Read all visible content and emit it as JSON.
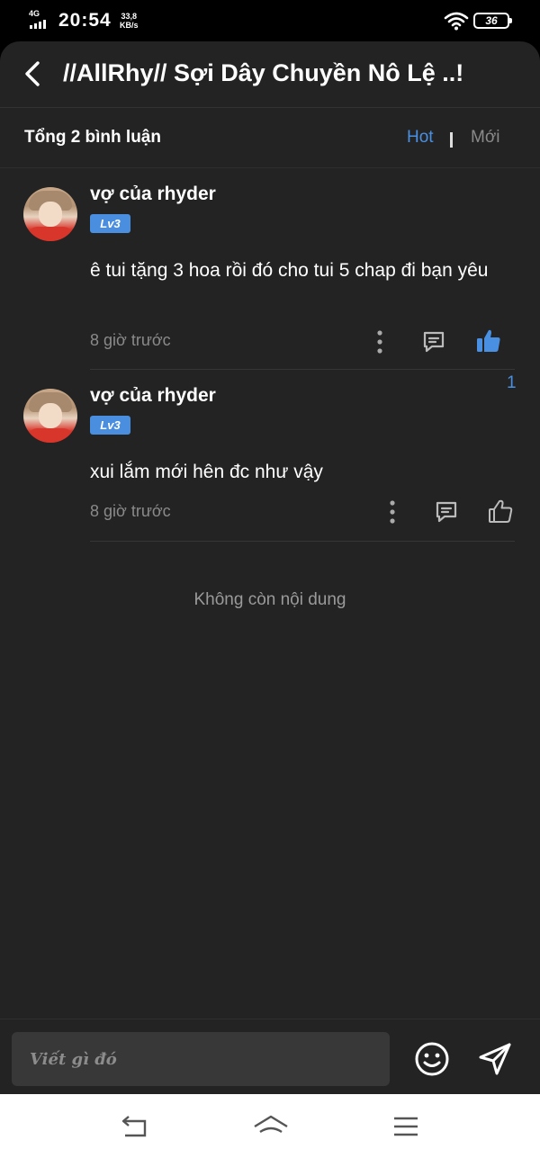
{
  "status_bar": {
    "network": "4G",
    "time": "20:54",
    "speed_value": "33,8",
    "speed_unit": "KB/s",
    "battery": "36"
  },
  "header": {
    "title": "//AllRhy// Sợi Dây Chuyền Nô Lệ ..!",
    "back_icon": "chevron-left-icon"
  },
  "comments_header": {
    "count_label": "Tổng 2 bình luận",
    "sort_hot": "Hot",
    "sort_new": "Mới",
    "active_sort": "Hot"
  },
  "comments": [
    {
      "username": "vợ của rhyder",
      "level": "Lv3",
      "text": "ê tui tặng 3 hoa rồi đó cho tui 5 chap đi  bạn yêu",
      "time": "8 giờ trước",
      "likes": "1",
      "liked": true
    },
    {
      "username": "vợ của rhyder",
      "level": "Lv3",
      "text": "xui lắm mới hên đc như vậy",
      "time": "8 giờ trước",
      "likes": "",
      "liked": false
    }
  ],
  "end_message": "Không còn nội dung",
  "input": {
    "placeholder": "Viết gì đó"
  },
  "colors": {
    "accent": "#4a90e2",
    "background": "#232323",
    "level_badge": "#4a8ee0"
  }
}
